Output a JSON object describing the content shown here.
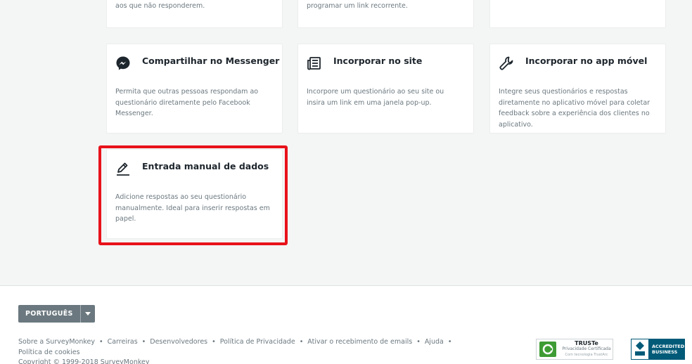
{
  "top_row": [
    {
      "desc": "aos que não responderem."
    },
    {
      "desc": "programar um link recorrente."
    },
    {
      "desc": ""
    }
  ],
  "cards": [
    {
      "title": "Compartilhar no Messenger",
      "icon": "messenger-icon",
      "desc": "Permita que outras pessoas respondam ao questionário diretamente pelo Facebook Messenger."
    },
    {
      "title": "Incorporar no site",
      "icon": "website-embed-icon",
      "desc": "Incorpore um questionário ao seu site ou insira um link em uma janela pop-up."
    },
    {
      "title": "Incorporar no app móvel",
      "icon": "wrench-icon",
      "desc": "Integre seus questionários e respostas diretamente no aplicativo móvel para coletar feedback sobre a experiência dos clientes no aplicativo."
    },
    {
      "title": "Entrada manual de dados",
      "icon": "pencil-icon",
      "desc": "Adicione respostas ao seu questionário manualmente. Ideal para inserir respostas em papel."
    }
  ],
  "highlight_color": "#e8121a",
  "footer": {
    "language_label": "PORTUGUÊS",
    "links": [
      "Sobre a SurveyMonkey",
      "Carreiras",
      "Desenvolvedores",
      "Política de Privacidade",
      "Ativar o recebimento de emails",
      "Ajuda"
    ],
    "links_line2": "Política de cookies",
    "copyright": "Copyright © 1999-2018 SurveyMonkey",
    "truste": {
      "title": "TRUSTe",
      "subtitle": "Privacidade Certificada",
      "small": "Com tecnologia TrustArc"
    },
    "bbb": {
      "line1": "ACCREDITED",
      "line2": "BUSINESS",
      "seal": "BBB."
    }
  }
}
